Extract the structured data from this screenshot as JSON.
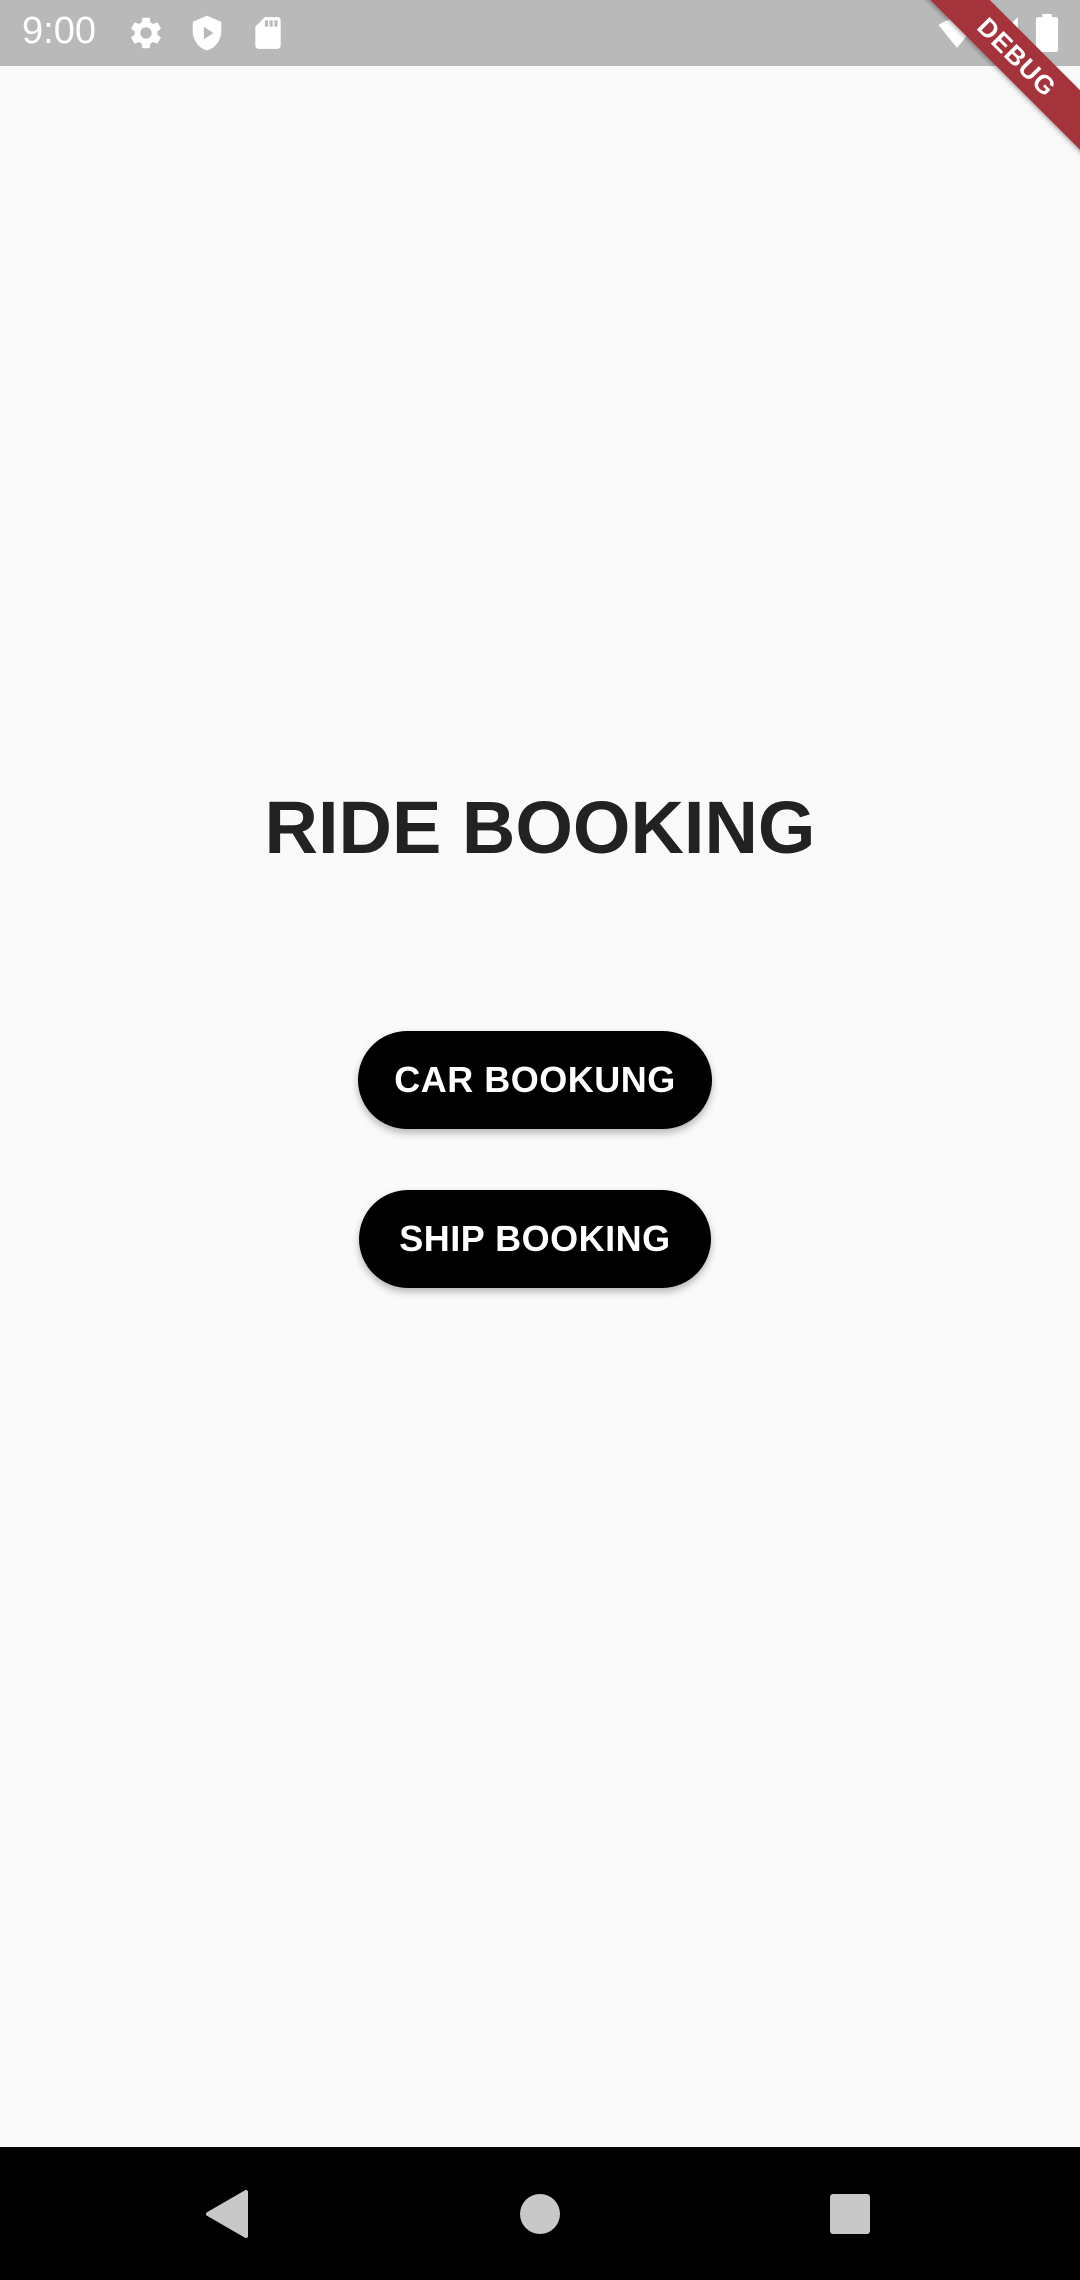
{
  "status_bar": {
    "time": "9:00",
    "icons": [
      "settings-icon",
      "shield-play-icon",
      "sd-card-icon",
      "wifi-icon",
      "cellular-icon",
      "battery-icon"
    ]
  },
  "debug_banner": {
    "label": "DEBUG",
    "color": "#a5333b"
  },
  "main": {
    "title": "RIDE BOOKING",
    "buttons": [
      {
        "label": "CAR BOOKUNG"
      },
      {
        "label": "SHIP BOOKING"
      }
    ]
  },
  "nav_bar": {
    "icons": [
      "back-icon",
      "home-icon",
      "recents-icon"
    ]
  },
  "colors": {
    "background": "#fafafa",
    "status_bar": "#b9b9b9",
    "button_bg": "#000000",
    "button_text": "#ffffff",
    "title_text": "#222222"
  }
}
